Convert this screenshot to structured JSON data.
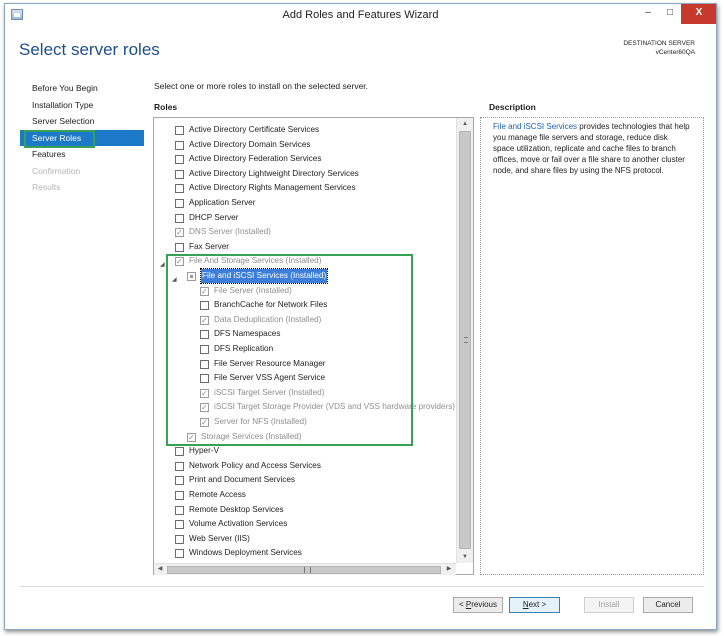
{
  "window": {
    "title": "Add Roles and Features Wizard",
    "minimize": "–",
    "maximize": "□",
    "close": "X"
  },
  "header": {
    "page_title": "Select server roles",
    "destination_label": "DESTINATION SERVER",
    "destination_server": "vCenter60QA"
  },
  "nav": {
    "items": [
      {
        "label": "Before You Begin",
        "state": "normal"
      },
      {
        "label": "Installation Type",
        "state": "normal"
      },
      {
        "label": "Server Selection",
        "state": "normal"
      },
      {
        "label": "Server Roles",
        "state": "active"
      },
      {
        "label": "Features",
        "state": "normal"
      },
      {
        "label": "Confirmation",
        "state": "disabled"
      },
      {
        "label": "Results",
        "state": "disabled"
      }
    ]
  },
  "main": {
    "intro": "Select one or more roles to install on the selected server.",
    "roles_heading": "Roles",
    "roles": [
      {
        "label": "Active Directory Certificate Services",
        "level": 0,
        "checked": false,
        "disabled": false
      },
      {
        "label": "Active Directory Domain Services",
        "level": 0,
        "checked": false,
        "disabled": false
      },
      {
        "label": "Active Directory Federation Services",
        "level": 0,
        "checked": false,
        "disabled": false
      },
      {
        "label": "Active Directory Lightweight Directory Services",
        "level": 0,
        "checked": false,
        "disabled": false
      },
      {
        "label": "Active Directory Rights Management Services",
        "level": 0,
        "checked": false,
        "disabled": false
      },
      {
        "label": "Application Server",
        "level": 0,
        "checked": false,
        "disabled": false
      },
      {
        "label": "DHCP Server",
        "level": 0,
        "checked": false,
        "disabled": false
      },
      {
        "label": "DNS Server (Installed)",
        "level": 0,
        "checked": true,
        "disabled": true
      },
      {
        "label": "Fax Server",
        "level": 0,
        "checked": false,
        "disabled": false
      },
      {
        "label": "File And Storage Services (Installed)",
        "level": 0,
        "checked": true,
        "disabled": true,
        "expander": "◢"
      },
      {
        "label": "File and iSCSI Services (Installed)",
        "level": 1,
        "checked": "partial",
        "disabled": false,
        "expander": "◢",
        "selected": true
      },
      {
        "label": "File Server (Installed)",
        "level": 2,
        "checked": true,
        "disabled": true
      },
      {
        "label": "BranchCache for Network Files",
        "level": 2,
        "checked": false,
        "disabled": false
      },
      {
        "label": "Data Deduplication (Installed)",
        "level": 2,
        "checked": true,
        "disabled": true
      },
      {
        "label": "DFS Namespaces",
        "level": 2,
        "checked": false,
        "disabled": false
      },
      {
        "label": "DFS Replication",
        "level": 2,
        "checked": false,
        "disabled": false
      },
      {
        "label": "File Server Resource Manager",
        "level": 2,
        "checked": false,
        "disabled": false
      },
      {
        "label": "File Server VSS Agent Service",
        "level": 2,
        "checked": false,
        "disabled": false
      },
      {
        "label": "iSCSI Target Server (Installed)",
        "level": 2,
        "checked": true,
        "disabled": true
      },
      {
        "label": "iSCSI Target Storage Provider (VDS and VSS hardware providers) (In",
        "level": 2,
        "checked": true,
        "disabled": true
      },
      {
        "label": "Server for NFS (Installed)",
        "level": 2,
        "checked": true,
        "disabled": true
      },
      {
        "label": "Storage Services (Installed)",
        "level": 1,
        "checked": true,
        "disabled": true
      },
      {
        "label": "Hyper-V",
        "level": 0,
        "checked": false,
        "disabled": false
      },
      {
        "label": "Network Policy and Access Services",
        "level": 0,
        "checked": false,
        "disabled": false
      },
      {
        "label": "Print and Document Services",
        "level": 0,
        "checked": false,
        "disabled": false
      },
      {
        "label": "Remote Access",
        "level": 0,
        "checked": false,
        "disabled": false
      },
      {
        "label": "Remote Desktop Services",
        "level": 0,
        "checked": false,
        "disabled": false
      },
      {
        "label": "Volume Activation Services",
        "level": 0,
        "checked": false,
        "disabled": false
      },
      {
        "label": "Web Server (IIS)",
        "level": 0,
        "checked": false,
        "disabled": false
      },
      {
        "label": "Windows Deployment Services",
        "level": 0,
        "checked": false,
        "disabled": false
      }
    ],
    "scroll": {
      "up": "▲",
      "down": "▼",
      "left": "◀",
      "right": "▶"
    }
  },
  "description": {
    "heading": "Description",
    "link": "File and iSCSI Services",
    "text": " provides technologies that help you manage file servers and storage, reduce disk space utilization, replicate and cache files to branch offices, move or fail over a file share to another cluster node, and share files by using the NFS protocol."
  },
  "footer": {
    "previous_prefix": "< ",
    "previous_key": "P",
    "previous_rest": "revious",
    "next_key": "N",
    "next_rest": "ext >",
    "install": "Install",
    "cancel": "Cancel"
  },
  "colors": {
    "accent": "#1c79c8",
    "highlight_box": "#36a256",
    "title": "#1e4e8c"
  }
}
